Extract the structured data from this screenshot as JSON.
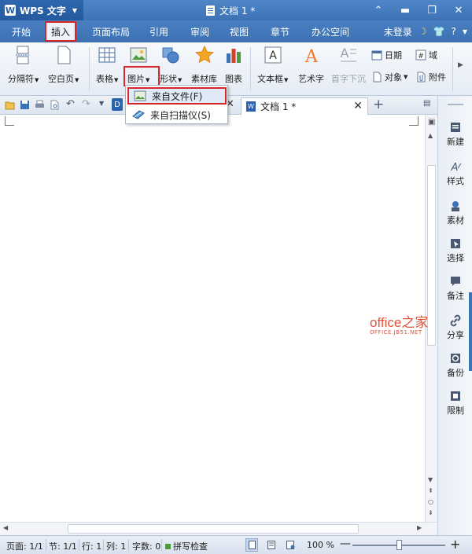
{
  "titlebar": {
    "app_name": "WPS 文字",
    "app_letter": "W",
    "doc_title": "文档 1 *"
  },
  "menubar": {
    "tabs": [
      "开始",
      "插入",
      "页面布局",
      "引用",
      "审阅",
      "视图",
      "章节",
      "办公空间"
    ],
    "active_tab": "插入",
    "login": "未登录",
    "help": "?"
  },
  "ribbon": {
    "buttons": {
      "separator": "分隔符",
      "blank_page": "空白页",
      "table": "表格",
      "picture": "图片",
      "shape": "形状",
      "material": "素材库",
      "chart": "图表",
      "textbox": "文本框",
      "wordart": "艺术字",
      "dropcap": "首字下沉",
      "date": "日期",
      "field": "域",
      "object": "对象",
      "attachment": "附件"
    }
  },
  "dropdown": {
    "items": [
      "来自文件(F)",
      "来自扫描仪(S)"
    ]
  },
  "doc_tab": {
    "label": "文档 1 *",
    "icon_letter": "W"
  },
  "taskpane": {
    "items": [
      "新建",
      "样式",
      "素材",
      "选择",
      "备注",
      "分享",
      "备份",
      "限制"
    ]
  },
  "watermark": {
    "line1": "office之家",
    "line2": "OFFICE.JB51.NET"
  },
  "statusbar": {
    "page": "页面: 1/1",
    "section": "节: 1/1",
    "row": "行: 1",
    "col": "列: 1",
    "word_count": "字数: 0",
    "spellcheck": "拼写检查",
    "zoom": "100 %"
  },
  "colors": {
    "accent": "#3d73b5",
    "highlight": "#d7262a"
  }
}
